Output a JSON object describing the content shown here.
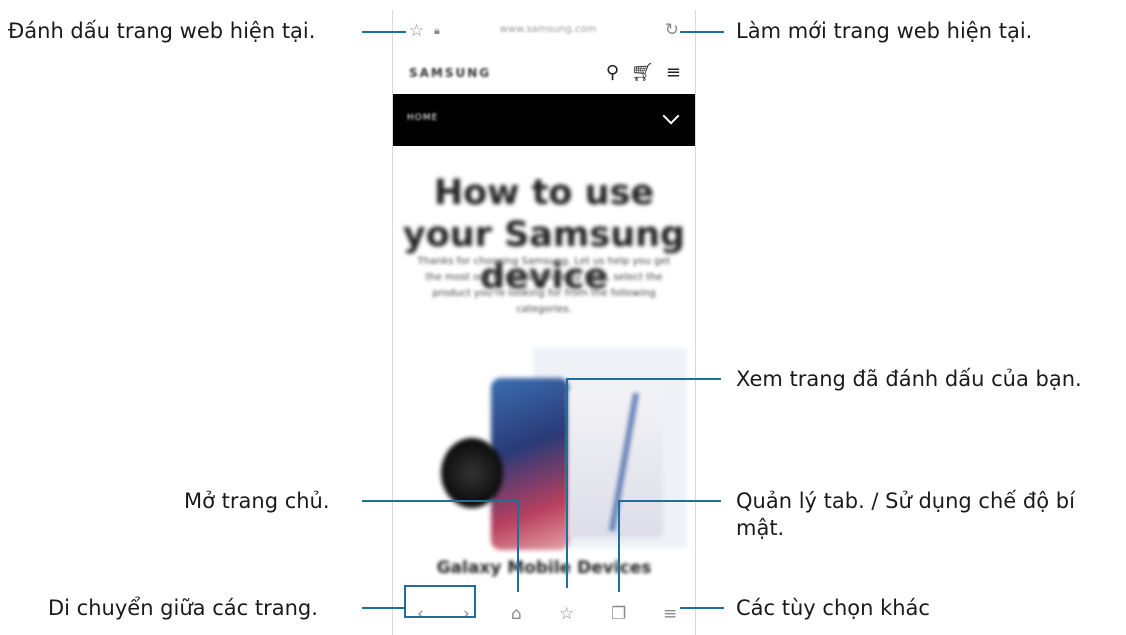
{
  "callouts": {
    "bookmark_current": "Đánh dấu trang web hiện tại.",
    "refresh": "Làm mới trang web hiện tại.",
    "view_bookmarks": "Xem trang đã đánh dấu của bạn.",
    "home": "Mở trang chủ.",
    "tabs_line1": "Quản lý tab. / Sử dụng chế độ bí",
    "tabs_line2": "mật.",
    "navigate": "Di chuyển giữa các trang.",
    "more": "Các tùy chọn khác"
  },
  "browser": {
    "url": "www.samsung.com",
    "site_logo": "SAMSUNG",
    "nav_label": "HOME",
    "hero_title": "How to use your Samsung device",
    "hero_sub": "Thanks for choosing Samsung. Let us help you get the most out of our technology. First, select the product you're looking for from the following categories.",
    "section_title": "Galaxy Mobile Devices"
  },
  "icons": {
    "bookmark": "star-outline",
    "lock": "lock",
    "reload": "refresh",
    "search": "magnifier",
    "cart": "cart",
    "menu": "hamburger",
    "back": "chevron-left",
    "forward": "chevron-right",
    "home": "house",
    "bookmarks": "star-list",
    "tabs": "tabs",
    "more": "hamburger"
  },
  "colors": {
    "callout_line": "#1f6f9a",
    "nav_bar": "#000000"
  }
}
